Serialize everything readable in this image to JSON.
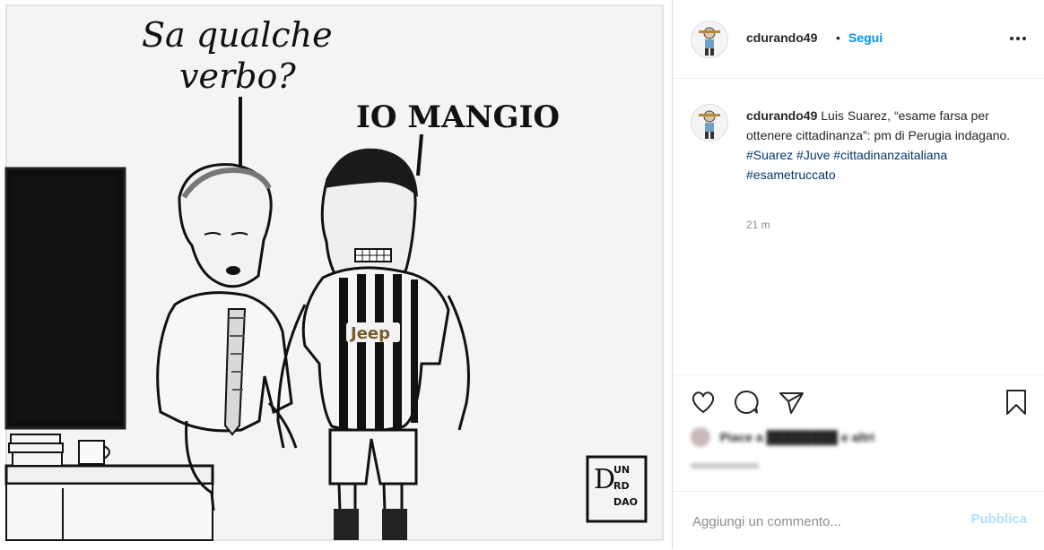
{
  "post": {
    "username": "cdurando49",
    "follow_label": "Segui",
    "dot": "•"
  },
  "image": {
    "speech_left": [
      "Sa qualche",
      "verbo?"
    ],
    "speech_right": "IO MANGIO",
    "jersey_sponsor": "Jeep",
    "signature": "UNRDDAO"
  },
  "caption": {
    "username": "cdurando49",
    "text": "Luis Suarez, “esame farsa per ottenere cittadinanza”: pm di Perugia indagano.",
    "hashtags": [
      "#Suarez",
      "#Juve",
      "#cittadinanzaitaliana",
      "#esametruccato"
    ],
    "time": "21 m"
  },
  "likes": {
    "text": "Piace a ████████ e altri"
  },
  "comment": {
    "placeholder": "Aggiungi un commento...",
    "publish_label": "Pubblica"
  },
  "icons": [
    "heart-icon",
    "comment-icon",
    "share-icon",
    "bookmark-icon",
    "more-icon"
  ]
}
